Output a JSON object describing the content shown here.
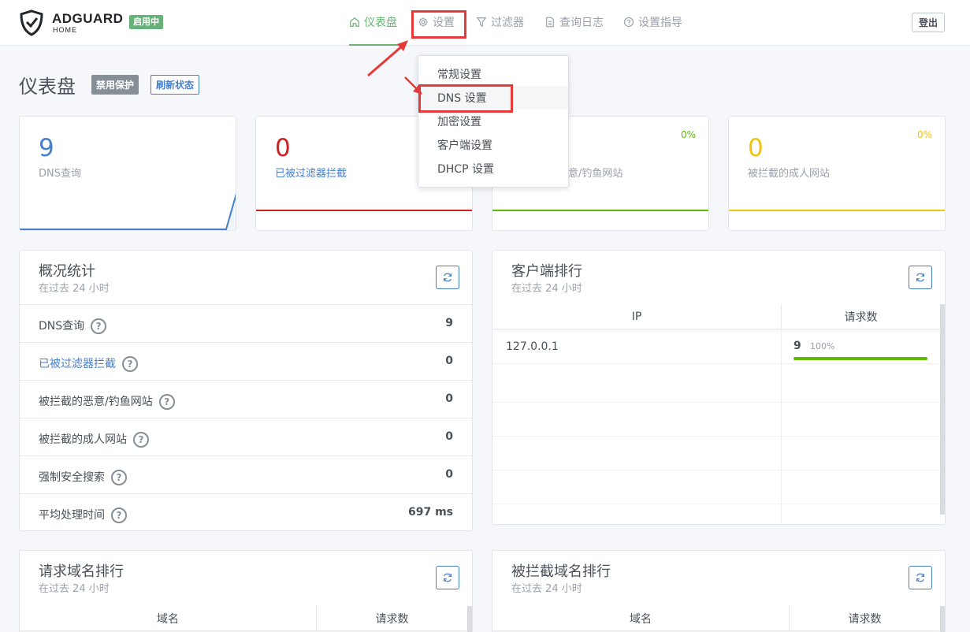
{
  "header": {
    "brand": "ADGUARD",
    "brand_sub": "HOME",
    "status_badge": "启用中",
    "nav": [
      {
        "label": "仪表盘",
        "icon": "home-icon"
      },
      {
        "label": "设置",
        "icon": "gear-icon"
      },
      {
        "label": "过滤器",
        "icon": "filter-icon"
      },
      {
        "label": "查询日志",
        "icon": "document-icon"
      },
      {
        "label": "设置指导",
        "icon": "help-circle-icon"
      }
    ],
    "logout": "登出"
  },
  "colors": {
    "accent_green": "#66b574",
    "blue": "#467fcf",
    "red": "#cd201f",
    "yellow": "#f1c40f",
    "annotation": "#e53a3a"
  },
  "page": {
    "title": "仪表盘",
    "disable_btn": "禁用保护",
    "refresh_btn": "刷新状态"
  },
  "stats": [
    {
      "value": "9",
      "label": "DNS查询",
      "pct": ""
    },
    {
      "value": "0",
      "label": "已被过滤器拦截",
      "pct": ""
    },
    {
      "value": "",
      "label": "意/钓鱼网站",
      "pct": "0%"
    },
    {
      "value": "0",
      "label": "被拦截的成人网站",
      "pct": "0%"
    }
  ],
  "overview": {
    "title": "概况统计",
    "subtitle": "在过去 24 小时",
    "rows": [
      {
        "label": "DNS查询",
        "value": "9"
      },
      {
        "label": "已被过滤器拦截",
        "value": "0"
      },
      {
        "label": "被拦截的恶意/钓鱼网站",
        "value": "0"
      },
      {
        "label": "被拦截的成人网站",
        "value": "0"
      },
      {
        "label": "强制安全搜索",
        "value": "0"
      },
      {
        "label": "平均处理时间",
        "value": "697 ms"
      }
    ]
  },
  "clients": {
    "title": "客户端排行",
    "subtitle": "在过去 24 小时",
    "col_ip": "IP",
    "col_count": "请求数",
    "rows": [
      {
        "ip": "127.0.0.1",
        "count": "9",
        "pct": "100%",
        "fraction": 1.0
      }
    ]
  },
  "top_domains": {
    "title": "请求域名排行",
    "subtitle": "在过去 24 小时",
    "col_domain": "域名",
    "col_count": "请求数"
  },
  "blocked_domains": {
    "title": "被拦截域名排行",
    "subtitle": "在过去 24 小时",
    "col_domain": "域名",
    "col_count": "请求数"
  },
  "settings_menu": {
    "items": [
      "常规设置",
      "DNS 设置",
      "加密设置",
      "客户端设置",
      "DHCP 设置"
    ]
  }
}
